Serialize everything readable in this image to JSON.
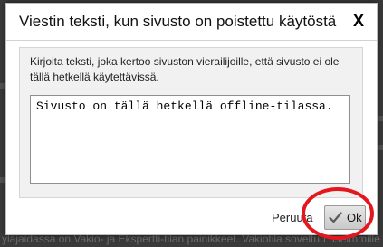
{
  "background": {
    "bottom_text": "yläjaidassa on Vakio- ja Ekspertti-tilan painikkeet. Vakiotila soveltuu useimmille"
  },
  "dialog": {
    "title": "Viestin teksti, kun sivusto on poistettu käytöstä",
    "close_label": "X",
    "instruction": "Kirjoita teksti, joka kertoo sivuston vierailijoille, että sivusto ei ole tällä hetkellä käytettävissä.",
    "message_value": "Sivusto on tällä hetkellä offline-tilassa.",
    "cancel_label": "Peruuta",
    "ok_label": "Ok",
    "ok_icon": "checkmark-icon"
  },
  "colors": {
    "annotation": "#e4171e",
    "overlay": "#3a3a3a"
  }
}
